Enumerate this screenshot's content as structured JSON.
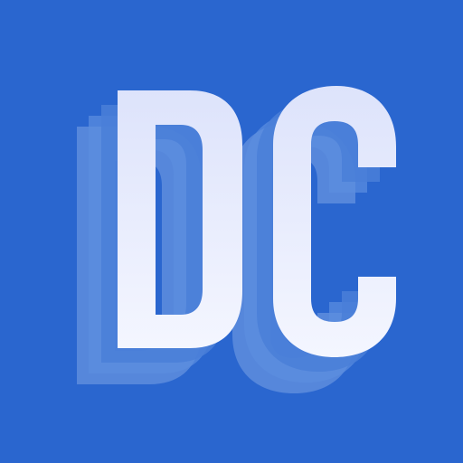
{
  "app_icon": {
    "logo_text": "DC",
    "icon_name": "dc-letters-logo-icon",
    "colors": {
      "background": "#2a66cf",
      "letter_top": "#dde3fb",
      "letter_bottom": "#f4f6ff",
      "shadow_1": "#4a7fd8",
      "shadow_2": "#5d8ee0",
      "shadow_3": "#7aa3e6"
    }
  }
}
